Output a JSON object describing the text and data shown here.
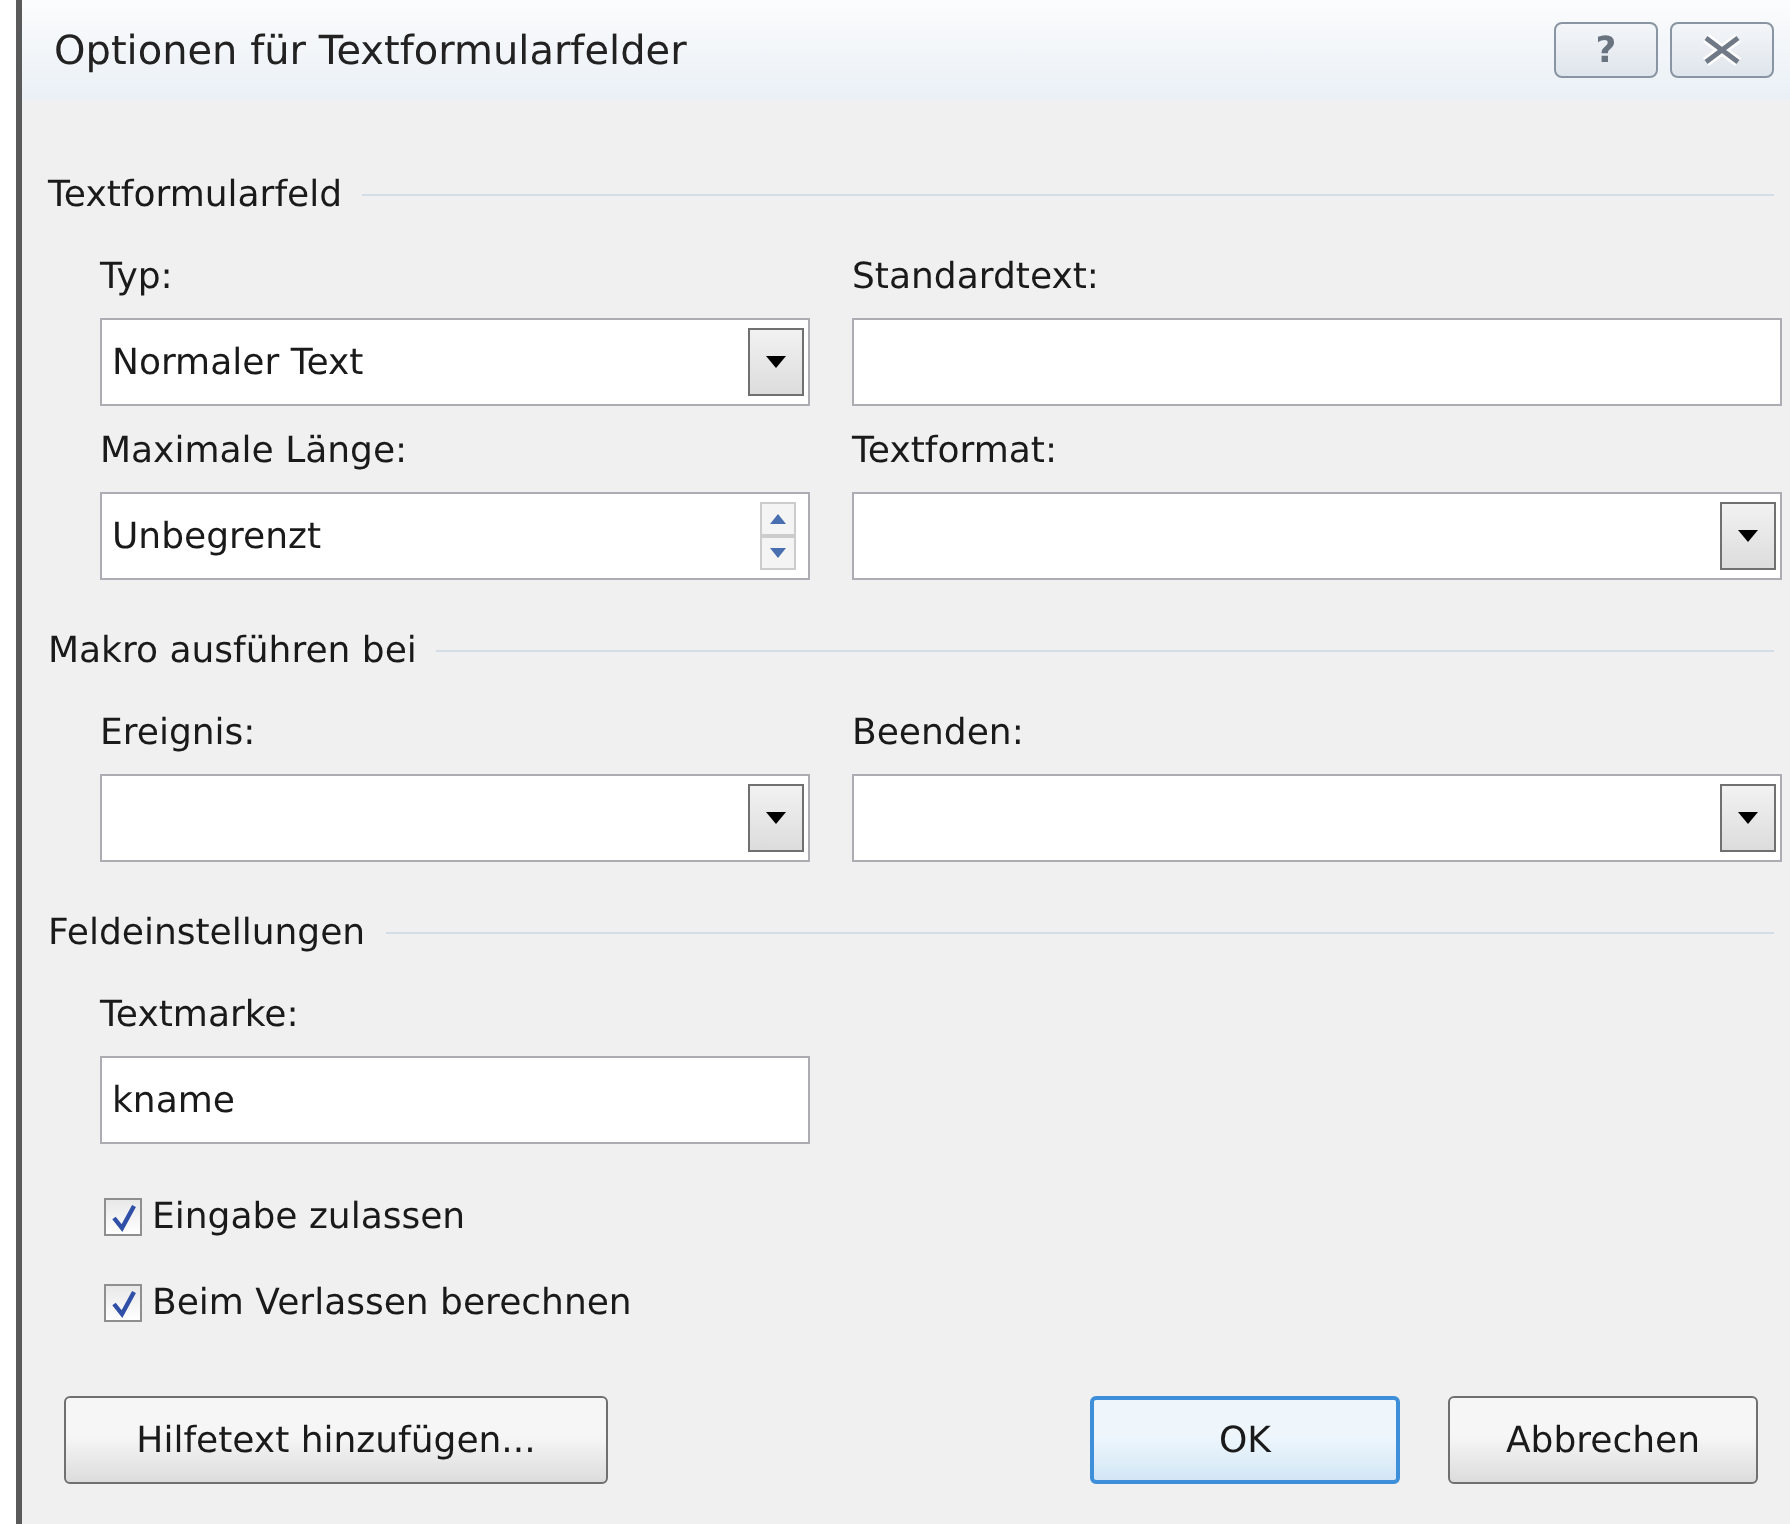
{
  "window": {
    "title": "Optionen für Textformularfelder",
    "help": "?"
  },
  "sections": [
    {
      "title": "Textformularfeld",
      "fields": [
        {
          "label": "Typ:",
          "kind": "dropdown",
          "value": "Normaler Text"
        },
        {
          "label": "Standardtext:",
          "kind": "text"
        },
        {
          "label": "Maximale Länge:",
          "kind": "spinner",
          "value": "Unbegrenzt"
        },
        {
          "label": "Textformat:",
          "kind": "dropdown"
        }
      ]
    },
    {
      "title": "Makro ausführen bei",
      "fields": [
        {
          "label": "Ereignis:",
          "kind": "dropdown"
        },
        {
          "label": "Beenden:",
          "kind": "dropdown"
        }
      ]
    },
    {
      "title": "Feldeinstellungen",
      "fields": [
        {
          "label": "Textmarke:",
          "kind": "text",
          "value": "kname"
        }
      ],
      "checkboxes": [
        {
          "label": "Eingabe zulassen",
          "checked": true
        },
        {
          "label": "Beim Verlassen berechnen",
          "checked": true
        }
      ]
    }
  ],
  "buttons": [
    {
      "label": "Hilfetext hinzufügen...",
      "kind": "left",
      "default": false
    },
    {
      "label": "OK",
      "kind": "right",
      "default": true
    },
    {
      "label": "Abbrechen",
      "kind": "right",
      "default": false
    }
  ]
}
